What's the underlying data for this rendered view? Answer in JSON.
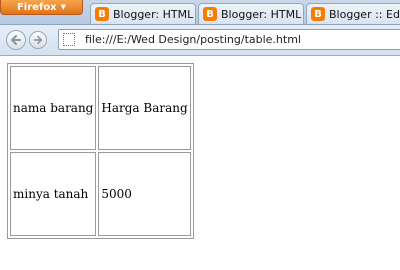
{
  "browser": {
    "menu_button_label": "Firefox",
    "tabs": [
      {
        "label": "Blogger: HTML ...",
        "icon": "blogger-icon"
      },
      {
        "label": "Blogger: HTML ...",
        "icon": "blogger-icon"
      },
      {
        "label": "Blogger :: Edit T",
        "icon": "blogger-icon"
      }
    ],
    "favicon_glyph": "B",
    "address": "file:///E:/Wed Design/posting/table.html",
    "colors": {
      "firefox_button": "#e0741a",
      "blogger": "#f57d00"
    }
  },
  "page": {
    "table": {
      "rows": [
        [
          "nama barang",
          "Harga Barang"
        ],
        [
          "minya tanah",
          "5000"
        ]
      ]
    }
  }
}
